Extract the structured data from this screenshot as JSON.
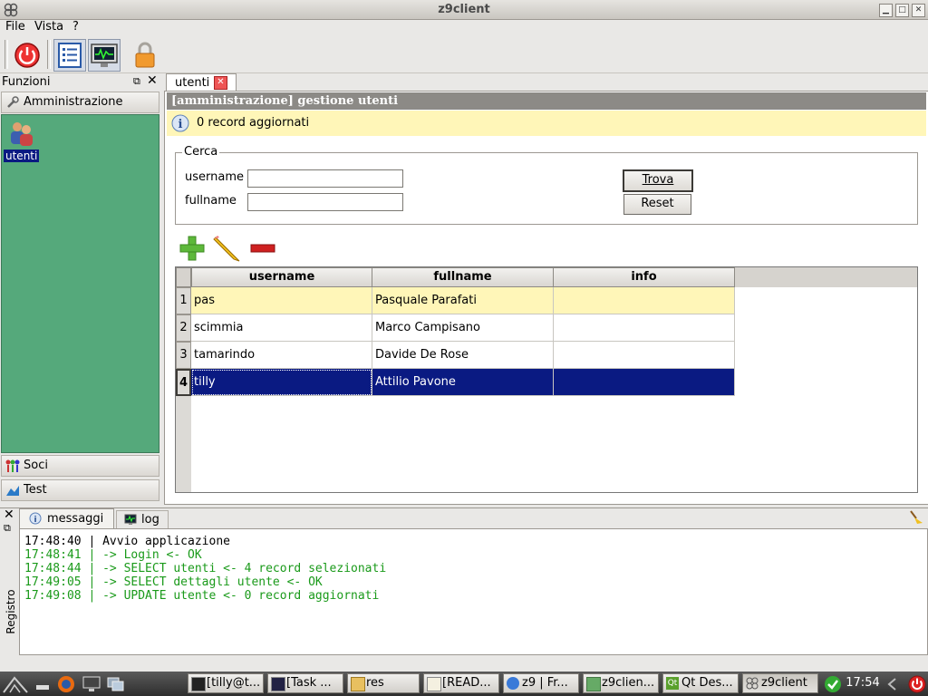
{
  "window": {
    "title": "z9client"
  },
  "menubar": {
    "items": [
      "File",
      "Vista",
      "?"
    ]
  },
  "toolbar": {
    "buttons": [
      "power-icon",
      "list-icon",
      "monitor-icon",
      "lock-icon"
    ]
  },
  "left_panel": {
    "title": "Funzioni",
    "sections": [
      {
        "label": "Amministrazione",
        "icon": "tools-icon"
      },
      {
        "label": "Soci",
        "icon": "people-icon"
      },
      {
        "label": "Test",
        "icon": "test-icon"
      }
    ],
    "items": [
      {
        "label": "utenti",
        "icon": "users-icon",
        "selected": true
      }
    ]
  },
  "main": {
    "tab": {
      "label": "utenti"
    },
    "header": "[amministrazione] gestione utenti",
    "info": "0 record aggiornati",
    "search": {
      "legend": "Cerca",
      "username_label": "username",
      "fullname_label": "fullname",
      "username_value": "",
      "fullname_value": "",
      "find_label": "Trova",
      "reset_label": "Reset"
    },
    "actions": [
      "add-icon",
      "edit-icon",
      "delete-icon"
    ],
    "table": {
      "columns": [
        "username",
        "fullname",
        "info"
      ],
      "rows": [
        {
          "num": "1",
          "username": "pas",
          "fullname": "Pasquale Parafati",
          "info": "",
          "state": "current"
        },
        {
          "num": "2",
          "username": "scimmia",
          "fullname": "Marco Campisano",
          "info": "",
          "state": ""
        },
        {
          "num": "3",
          "username": "tamarindo",
          "fullname": "Davide De Rose",
          "info": "",
          "state": ""
        },
        {
          "num": "4",
          "username": "tilly",
          "fullname": "Attilio Pavone",
          "info": "",
          "state": "selected"
        }
      ]
    }
  },
  "log": {
    "tabs": [
      "messaggi",
      "log"
    ],
    "side_label": "Registro",
    "lines": [
      {
        "text": "17:48:40 | Avvio applicazione",
        "color": "#000000"
      },
      {
        "text": "17:48:41 | -> Login <- OK",
        "color": "#1a9a1a"
      },
      {
        "text": "17:48:44 | -> SELECT utenti <- 4 record selezionati",
        "color": "#1a9a1a"
      },
      {
        "text": "17:49:05 | -> SELECT dettagli utente <- OK",
        "color": "#1a9a1a"
      },
      {
        "text": "17:49:08 | -> UPDATE utente <- 0 record aggiornati",
        "color": "#1a9a1a"
      }
    ]
  },
  "taskbar": {
    "tasks": [
      "[tilly@t...",
      "[Task ...",
      "res",
      "[READ...",
      "z9 | Fr...",
      "z9clien...",
      "Qt Des...",
      "z9client"
    ],
    "clock": "17:54"
  },
  "colors": {
    "accent": "#0a1a82",
    "sidebar_bg": "#55a97b",
    "highlight_row": "#fff6b8",
    "log_green": "#1a9a1a"
  }
}
